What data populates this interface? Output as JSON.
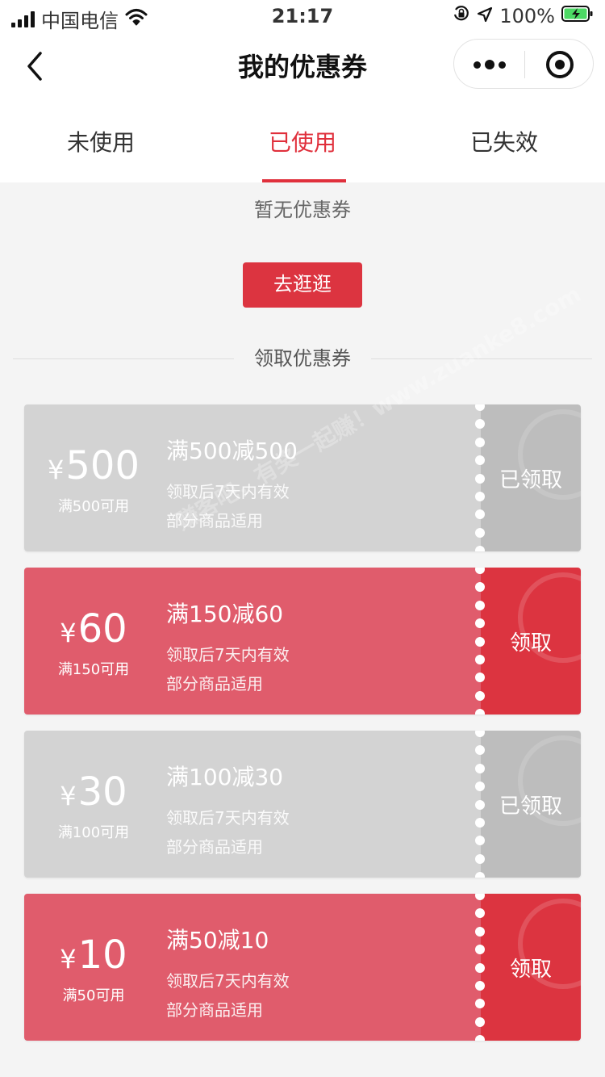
{
  "status_bar": {
    "carrier": "中国电信",
    "time": "21:17",
    "battery": "100%"
  },
  "nav": {
    "title": "我的优惠券"
  },
  "tabs": [
    {
      "label": "未使用",
      "active": false
    },
    {
      "label": "已使用",
      "active": true
    },
    {
      "label": "已失效",
      "active": false
    }
  ],
  "empty": {
    "text": "暂无优惠券",
    "button": "去逛逛"
  },
  "section": {
    "title": "领取优惠券"
  },
  "coupons": [
    {
      "currency": "¥",
      "amount": "500",
      "min_spend": "满500可用",
      "title": "满500减500",
      "validity": "领取后7天内有效",
      "scope": "部分商品适用",
      "action": "已领取",
      "state": "claimed"
    },
    {
      "currency": "¥",
      "amount": "60",
      "min_spend": "满150可用",
      "title": "满150减60",
      "validity": "领取后7天内有效",
      "scope": "部分商品适用",
      "action": "领取",
      "state": "available"
    },
    {
      "currency": "¥",
      "amount": "30",
      "min_spend": "满100可用",
      "title": "满100减30",
      "validity": "领取后7天内有效",
      "scope": "部分商品适用",
      "action": "已领取",
      "state": "claimed"
    },
    {
      "currency": "¥",
      "amount": "10",
      "min_spend": "满50可用",
      "title": "满50减10",
      "validity": "领取后7天内有效",
      "scope": "部分商品适用",
      "action": "领取",
      "state": "available"
    }
  ],
  "watermark": "赚客吧，有奖一起赚！www.zuanke8.com",
  "colors": {
    "accent": "#e0303c",
    "claimed_main": "#d3d3d3",
    "claimed_action": "#bdbdbd",
    "available_main": "#e05c6c",
    "available_action": "#dc3440"
  }
}
